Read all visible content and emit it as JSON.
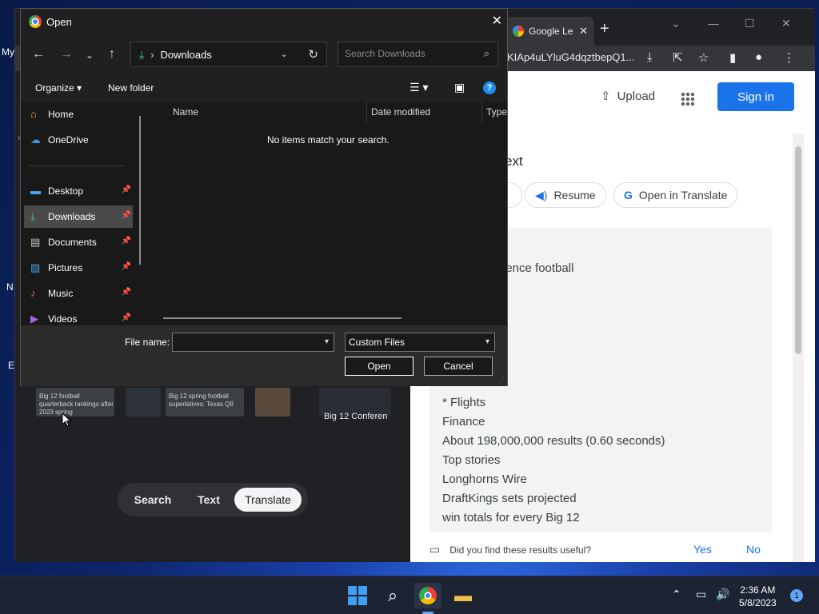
{
  "desktop": {
    "left_labels": [
      "My",
      "N",
      "E"
    ]
  },
  "browser": {
    "tab_title": "Google Le",
    "tab_close": "✕",
    "new_tab": "+",
    "url_fragment": "KIAp4uLYluG4dqztbepQ1...",
    "win_minimize": "—",
    "win_maximize": "☐",
    "win_close": "✕"
  },
  "lens": {
    "thumbnails": [
      "Big 12 football quarterback rankings after 2023 spring",
      "Big 12 spring football superlatives: Texas Q8",
      ""
    ],
    "thumb_caption": "Big 12 Conferen",
    "modes": [
      "Search",
      "Text",
      "Translate"
    ],
    "active_mode": "Translate"
  },
  "results": {
    "upload_label": "Upload",
    "signin_label": "Sign in",
    "title_fragment": "ext",
    "chips": {
      "resume": "Resume",
      "open_translate": "Open in Translate"
    },
    "text_lines": [
      "erence football",
      "* Flights",
      "Finance",
      "About 198,000,000 results (0.60 seconds)",
      "Top stories",
      "Longhorns Wire",
      "DraftKings sets projected",
      "win totals for every Big 12"
    ],
    "feedback_question": "Did you find these results useful?",
    "feedback_yes": "Yes",
    "feedback_no": "No"
  },
  "dialog": {
    "title": "Open",
    "close": "✕",
    "address_folder": "Downloads",
    "search_placeholder": "Search Downloads",
    "organize_label": "Organize ▾",
    "new_folder_label": "New folder",
    "nav_items": [
      {
        "label": "Home",
        "icon": "home-icon",
        "pinned": false
      },
      {
        "label": "OneDrive",
        "icon": "cloud-icon",
        "pinned": false
      },
      {
        "label": "Desktop",
        "icon": "desktop-icon",
        "pinned": true
      },
      {
        "label": "Downloads",
        "icon": "download-icon",
        "pinned": true,
        "selected": true
      },
      {
        "label": "Documents",
        "icon": "document-icon",
        "pinned": true
      },
      {
        "label": "Pictures",
        "icon": "pictures-icon",
        "pinned": true
      },
      {
        "label": "Music",
        "icon": "music-icon",
        "pinned": true
      },
      {
        "label": "Videos",
        "icon": "videos-icon",
        "pinned": true
      }
    ],
    "columns": [
      "Name",
      "Date modified",
      "Type"
    ],
    "empty_message": "No items match your search.",
    "file_name_label": "File name:",
    "file_name_value": "",
    "file_type_value": "Custom Files",
    "open_label": "Open",
    "cancel_label": "Cancel"
  },
  "taskbar": {
    "time": "2:36 AM",
    "date": "5/8/2023",
    "notification_count": "1"
  }
}
